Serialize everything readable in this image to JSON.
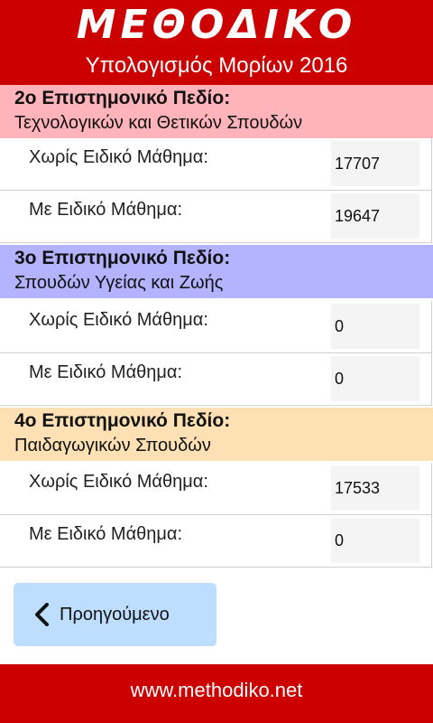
{
  "header": {
    "logo_text": "ΜΕΘΟΔΙΚΟ",
    "subtitle": "Υπολογισμός Μορίων 2016",
    "color": "#cc0000"
  },
  "sections": [
    {
      "title": "2ο Επιστημονικό Πεδίο:",
      "subtitle": "Τεχνολογικών και Θετικών Σπουδών",
      "color": "#ffb3ba",
      "rows": [
        {
          "label": "Χωρίς Ειδικό Μάθημα:",
          "value": "17707"
        },
        {
          "label": "Με Ειδικό Μάθημα:",
          "value": "19647"
        }
      ]
    },
    {
      "title": "3ο Επιστημονικό Πεδίο:",
      "subtitle": "Σπουδών Υγείας και Ζωής",
      "color": "#b3b3ff",
      "rows": [
        {
          "label": "Χωρίς Ειδικό Μάθημα:",
          "value": "0"
        },
        {
          "label": "Με Ειδικό Μάθημα:",
          "value": "0"
        }
      ]
    },
    {
      "title": "4ο Επιστημονικό Πεδίο:",
      "subtitle": "Παιδαγωγικών Σπουδών",
      "color": "#fde0b3",
      "rows": [
        {
          "label": "Χωρίς Ειδικό Μάθημα:",
          "value": "17533"
        },
        {
          "label": "Με Ειδικό Μάθημα:",
          "value": "0"
        }
      ]
    }
  ],
  "prev_button": {
    "label": "Προηγούμενο",
    "icon": "chevron-left-icon",
    "color": "#bddeff"
  },
  "footer": {
    "url": "www.methodiko.net"
  }
}
